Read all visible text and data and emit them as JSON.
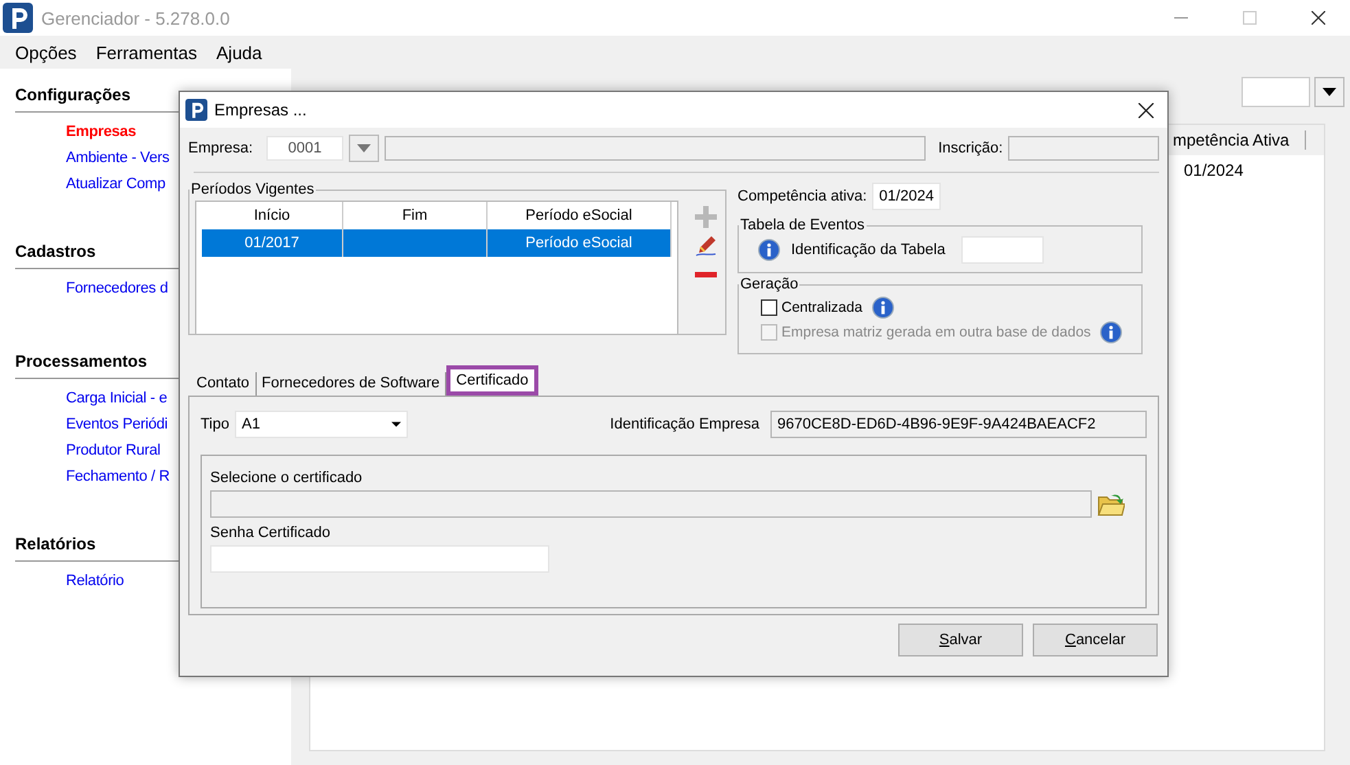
{
  "window": {
    "title": "Gerenciador - 5.278.0.0"
  },
  "menu": [
    "Opções",
    "Ferramentas",
    "Ajuda"
  ],
  "sidebar": {
    "sections": [
      {
        "title": "Configurações",
        "items": [
          {
            "label": "Empresas",
            "selected": true
          },
          {
            "label": "Ambiente - Vers",
            "selected": false
          },
          {
            "label": "Atualizar Comp",
            "selected": false
          }
        ]
      },
      {
        "title": "Cadastros",
        "items": [
          {
            "label": "Fornecedores d",
            "selected": false
          }
        ]
      },
      {
        "title": "Processamentos",
        "items": [
          {
            "label": "Carga Inicial - e",
            "selected": false
          },
          {
            "label": "Eventos Periódi",
            "selected": false
          },
          {
            "label": "Produtor Rural",
            "selected": false
          },
          {
            "label": "Fechamento / R",
            "selected": false
          }
        ]
      },
      {
        "title": "Relatórios",
        "items": [
          {
            "label": "Relatório",
            "selected": false
          }
        ]
      }
    ]
  },
  "main_table": {
    "columns": [
      "mpetência Ativa"
    ],
    "rows": [
      [
        "01/2024"
      ]
    ]
  },
  "dialog": {
    "title": "Empresas ...",
    "empresa": {
      "label": "Empresa:",
      "value": "0001"
    },
    "inscricao": {
      "label": "Inscrição:"
    },
    "periodos": {
      "title": "Períodos Vigentes",
      "columns": [
        "Início",
        "Fim",
        "Período eSocial"
      ],
      "rows": [
        {
          "inicio": "01/2017",
          "periodo_esocial": "Período eSocial",
          "selected": true
        }
      ]
    },
    "competencia": {
      "label": "Competência ativa:",
      "value": "01/2024"
    },
    "tabela_eventos": {
      "title": "Tabela de Eventos",
      "label": "Identificação da Tabela"
    },
    "geracao": {
      "title": "Geração",
      "options": [
        {
          "label": "Centralizada",
          "checked": false,
          "disabled": false
        },
        {
          "label": "Empresa matriz gerada em outra base de dados",
          "checked": false,
          "disabled": true
        }
      ]
    },
    "tabs": [
      {
        "label": "Contato",
        "selected": false,
        "highlighted": false
      },
      {
        "label": "Fornecedores de Software",
        "selected": false,
        "highlighted": false
      },
      {
        "label": "Certificado",
        "selected": true,
        "highlighted": true
      }
    ],
    "tipo": {
      "label": "Tipo",
      "value": "A1"
    },
    "identificacao_empresa": {
      "label": "Identificação Empresa",
      "value": "9670CE8D-ED6D-4B96-9E9F-9A424BAEACF2"
    },
    "certificado": {
      "label": "Selecione o certificado"
    },
    "senha": {
      "label": "Senha Certificado"
    },
    "buttons": [
      {
        "label": "Salvar"
      },
      {
        "label": "Cancelar"
      }
    ]
  }
}
